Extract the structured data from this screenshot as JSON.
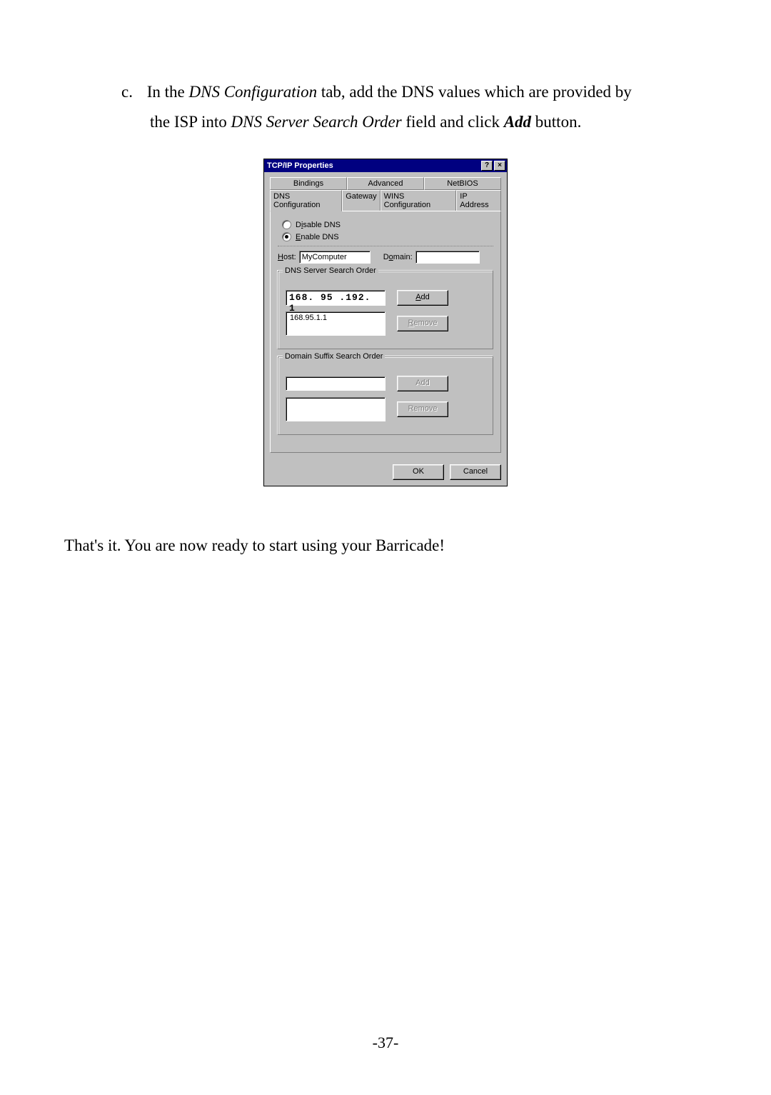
{
  "instruction": {
    "list_label": "c.",
    "part1": "In the ",
    "italic1": "DNS Configuration",
    "part2": " tab, add the DNS values which are provided by",
    "line2a": "the ISP into ",
    "italic2": "DNS Server Search Order",
    "line2b": " field and click ",
    "bold1": "Add",
    "line2c": " button."
  },
  "dialog": {
    "title": "TCP/IP Properties",
    "help_glyph": "?",
    "close_glyph": "×",
    "tabs_row1": {
      "bindings": "Bindings",
      "advanced": "Advanced",
      "netbios": "NetBIOS"
    },
    "tabs_row2": {
      "dns": "DNS Configuration",
      "gateway": "Gateway",
      "wins": "WINS Configuration",
      "ip": "IP Address"
    },
    "radio_disable_pre": "D",
    "radio_disable_mid": "i",
    "radio_disable_post": "sable DNS",
    "radio_enable_pre": "",
    "radio_enable_mid": "E",
    "radio_enable_post": "nable DNS",
    "host_label_pre": "",
    "host_label_u": "H",
    "host_label_post": "ost:",
    "host_value": "MyComputer",
    "domain_label_pre": "D",
    "domain_label_u": "o",
    "domain_label_post": "main:",
    "domain_value": "",
    "dns_group": "DNS Server Search Order",
    "dns_input": "168. 95 .192.  1",
    "dns_list_item": "168.95.1.1",
    "suffix_group": "Domain Suffix Search Order",
    "suffix_input": "",
    "btn_add_u": "A",
    "btn_add_post": "dd",
    "btn_remove_u": "R",
    "btn_remove_post": "emove",
    "btn_add2": "Add",
    "btn_remove2": "Remove",
    "ok": "OK",
    "cancel": "Cancel"
  },
  "closing": "That's it.  You are now ready to start using your Barricade!",
  "page_number": "-37-"
}
